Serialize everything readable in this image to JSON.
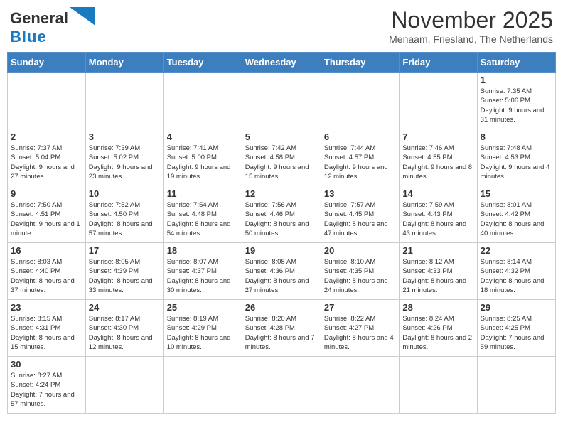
{
  "header": {
    "logo_general": "General",
    "logo_blue": "Blue",
    "month_title": "November 2025",
    "location": "Menaam, Friesland, The Netherlands"
  },
  "weekdays": [
    "Sunday",
    "Monday",
    "Tuesday",
    "Wednesday",
    "Thursday",
    "Friday",
    "Saturday"
  ],
  "weeks": [
    [
      null,
      null,
      null,
      null,
      null,
      null,
      {
        "day": "1",
        "sunrise": "Sunrise: 7:35 AM",
        "sunset": "Sunset: 5:06 PM",
        "daylight": "Daylight: 9 hours and 31 minutes."
      }
    ],
    [
      {
        "day": "2",
        "sunrise": "Sunrise: 7:37 AM",
        "sunset": "Sunset: 5:04 PM",
        "daylight": "Daylight: 9 hours and 27 minutes."
      },
      {
        "day": "3",
        "sunrise": "Sunrise: 7:39 AM",
        "sunset": "Sunset: 5:02 PM",
        "daylight": "Daylight: 9 hours and 23 minutes."
      },
      {
        "day": "4",
        "sunrise": "Sunrise: 7:41 AM",
        "sunset": "Sunset: 5:00 PM",
        "daylight": "Daylight: 9 hours and 19 minutes."
      },
      {
        "day": "5",
        "sunrise": "Sunrise: 7:42 AM",
        "sunset": "Sunset: 4:58 PM",
        "daylight": "Daylight: 9 hours and 15 minutes."
      },
      {
        "day": "6",
        "sunrise": "Sunrise: 7:44 AM",
        "sunset": "Sunset: 4:57 PM",
        "daylight": "Daylight: 9 hours and 12 minutes."
      },
      {
        "day": "7",
        "sunrise": "Sunrise: 7:46 AM",
        "sunset": "Sunset: 4:55 PM",
        "daylight": "Daylight: 9 hours and 8 minutes."
      },
      {
        "day": "8",
        "sunrise": "Sunrise: 7:48 AM",
        "sunset": "Sunset: 4:53 PM",
        "daylight": "Daylight: 9 hours and 4 minutes."
      }
    ],
    [
      {
        "day": "9",
        "sunrise": "Sunrise: 7:50 AM",
        "sunset": "Sunset: 4:51 PM",
        "daylight": "Daylight: 9 hours and 1 minute."
      },
      {
        "day": "10",
        "sunrise": "Sunrise: 7:52 AM",
        "sunset": "Sunset: 4:50 PM",
        "daylight": "Daylight: 8 hours and 57 minutes."
      },
      {
        "day": "11",
        "sunrise": "Sunrise: 7:54 AM",
        "sunset": "Sunset: 4:48 PM",
        "daylight": "Daylight: 8 hours and 54 minutes."
      },
      {
        "day": "12",
        "sunrise": "Sunrise: 7:56 AM",
        "sunset": "Sunset: 4:46 PM",
        "daylight": "Daylight: 8 hours and 50 minutes."
      },
      {
        "day": "13",
        "sunrise": "Sunrise: 7:57 AM",
        "sunset": "Sunset: 4:45 PM",
        "daylight": "Daylight: 8 hours and 47 minutes."
      },
      {
        "day": "14",
        "sunrise": "Sunrise: 7:59 AM",
        "sunset": "Sunset: 4:43 PM",
        "daylight": "Daylight: 8 hours and 43 minutes."
      },
      {
        "day": "15",
        "sunrise": "Sunrise: 8:01 AM",
        "sunset": "Sunset: 4:42 PM",
        "daylight": "Daylight: 8 hours and 40 minutes."
      }
    ],
    [
      {
        "day": "16",
        "sunrise": "Sunrise: 8:03 AM",
        "sunset": "Sunset: 4:40 PM",
        "daylight": "Daylight: 8 hours and 37 minutes."
      },
      {
        "day": "17",
        "sunrise": "Sunrise: 8:05 AM",
        "sunset": "Sunset: 4:39 PM",
        "daylight": "Daylight: 8 hours and 33 minutes."
      },
      {
        "day": "18",
        "sunrise": "Sunrise: 8:07 AM",
        "sunset": "Sunset: 4:37 PM",
        "daylight": "Daylight: 8 hours and 30 minutes."
      },
      {
        "day": "19",
        "sunrise": "Sunrise: 8:08 AM",
        "sunset": "Sunset: 4:36 PM",
        "daylight": "Daylight: 8 hours and 27 minutes."
      },
      {
        "day": "20",
        "sunrise": "Sunrise: 8:10 AM",
        "sunset": "Sunset: 4:35 PM",
        "daylight": "Daylight: 8 hours and 24 minutes."
      },
      {
        "day": "21",
        "sunrise": "Sunrise: 8:12 AM",
        "sunset": "Sunset: 4:33 PM",
        "daylight": "Daylight: 8 hours and 21 minutes."
      },
      {
        "day": "22",
        "sunrise": "Sunrise: 8:14 AM",
        "sunset": "Sunset: 4:32 PM",
        "daylight": "Daylight: 8 hours and 18 minutes."
      }
    ],
    [
      {
        "day": "23",
        "sunrise": "Sunrise: 8:15 AM",
        "sunset": "Sunset: 4:31 PM",
        "daylight": "Daylight: 8 hours and 15 minutes."
      },
      {
        "day": "24",
        "sunrise": "Sunrise: 8:17 AM",
        "sunset": "Sunset: 4:30 PM",
        "daylight": "Daylight: 8 hours and 12 minutes."
      },
      {
        "day": "25",
        "sunrise": "Sunrise: 8:19 AM",
        "sunset": "Sunset: 4:29 PM",
        "daylight": "Daylight: 8 hours and 10 minutes."
      },
      {
        "day": "26",
        "sunrise": "Sunrise: 8:20 AM",
        "sunset": "Sunset: 4:28 PM",
        "daylight": "Daylight: 8 hours and 7 minutes."
      },
      {
        "day": "27",
        "sunrise": "Sunrise: 8:22 AM",
        "sunset": "Sunset: 4:27 PM",
        "daylight": "Daylight: 8 hours and 4 minutes."
      },
      {
        "day": "28",
        "sunrise": "Sunrise: 8:24 AM",
        "sunset": "Sunset: 4:26 PM",
        "daylight": "Daylight: 8 hours and 2 minutes."
      },
      {
        "day": "29",
        "sunrise": "Sunrise: 8:25 AM",
        "sunset": "Sunset: 4:25 PM",
        "daylight": "Daylight: 7 hours and 59 minutes."
      }
    ],
    [
      {
        "day": "30",
        "sunrise": "Sunrise: 8:27 AM",
        "sunset": "Sunset: 4:24 PM",
        "daylight": "Daylight: 7 hours and 57 minutes."
      },
      null,
      null,
      null,
      null,
      null,
      null
    ]
  ]
}
